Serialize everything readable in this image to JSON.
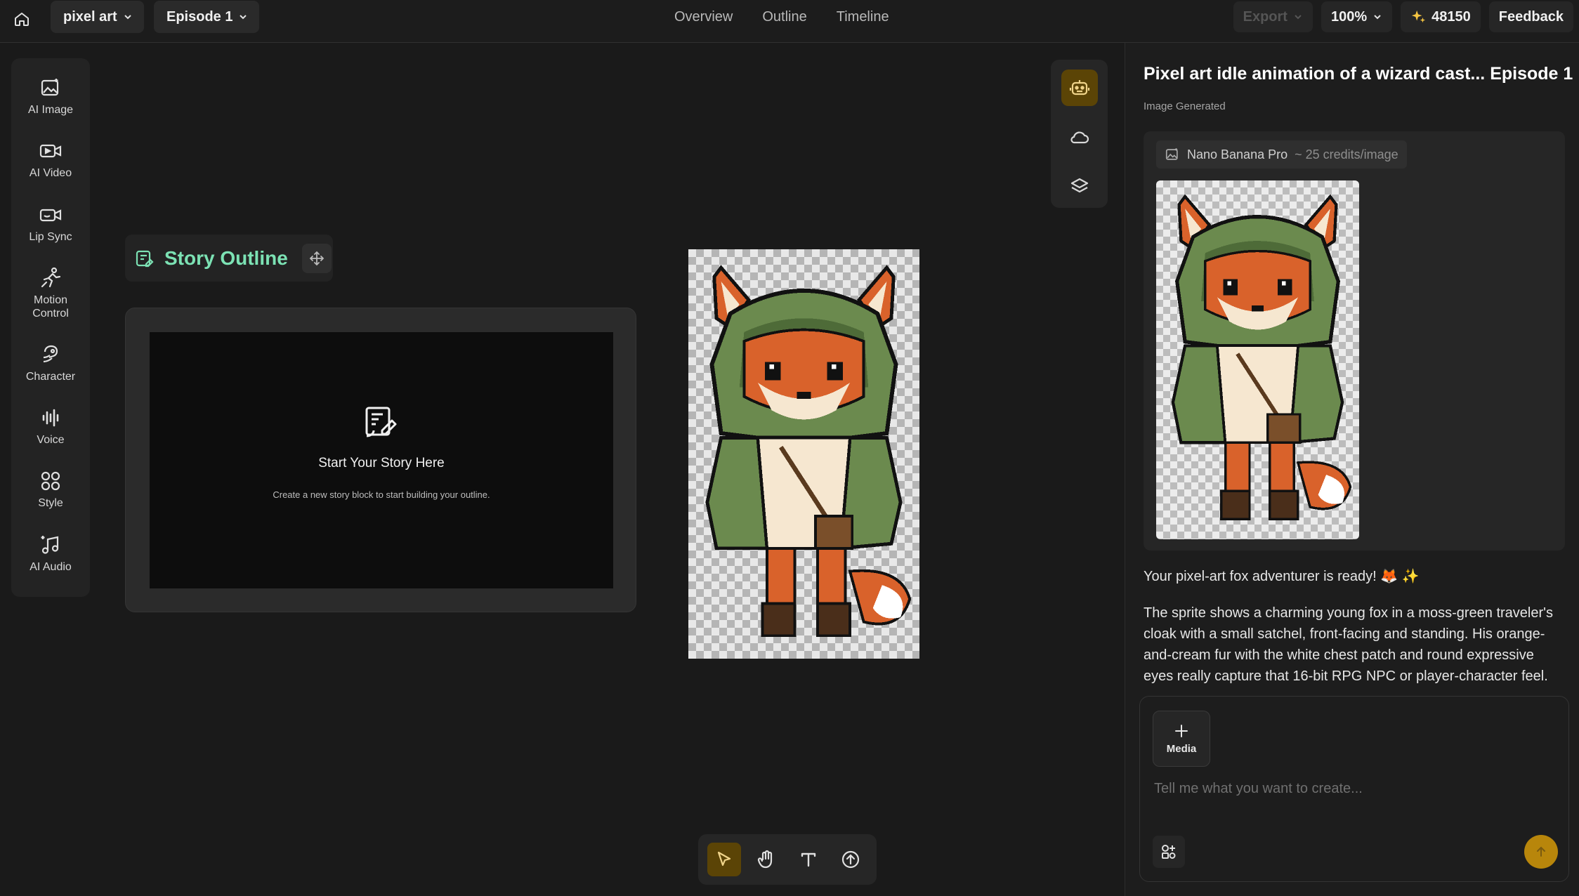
{
  "colors": {
    "accent": "#b8860b",
    "active_bg": "#5b4406",
    "outline_title": "#7ce2b4",
    "background": "#1a1a1a"
  },
  "topbar": {
    "project": "pixel art",
    "episode": "Episode 1",
    "nav": [
      "Overview",
      "Outline",
      "Timeline"
    ],
    "export_label": "Export",
    "zoom": "100%",
    "credits": "48150",
    "feedback_label": "Feedback"
  },
  "left_tools": [
    {
      "label": "AI Image",
      "icon": "ai-image-icon"
    },
    {
      "label": "AI Video",
      "icon": "ai-video-icon"
    },
    {
      "label": "Lip Sync",
      "icon": "lip-sync-icon"
    },
    {
      "label": "Motion Control",
      "icon": "motion-control-icon"
    },
    {
      "label": "Character",
      "icon": "character-icon"
    },
    {
      "label": "Voice",
      "icon": "voice-icon"
    },
    {
      "label": "Style",
      "icon": "style-icon"
    },
    {
      "label": "AI Audio",
      "icon": "ai-audio-icon"
    }
  ],
  "outline": {
    "title": "Story Outline",
    "empty_title": "Start Your Story Here",
    "empty_desc": "Create a new story block to start building your outline."
  },
  "panel": {
    "title": "Pixel art idle animation of a wizard cast... Episode 1",
    "status": "Image Generated",
    "model": "Nano Banana Pro",
    "model_credits": "~ 25 credits/image",
    "message_1": "Your pixel-art fox adventurer is ready! 🦊 ✨",
    "message_2": "The sprite shows a charming young fox in a moss-green traveler's cloak with a small satchel, front-facing and standing. His orange-and-cream fur with the white chest patch and round expressive eyes really capture that 16-bit RPG NPC or player-character feel. The earth-tone palette keeps it authentically retro.",
    "media_label": "Media",
    "input_placeholder": "Tell me what you want to create..."
  }
}
